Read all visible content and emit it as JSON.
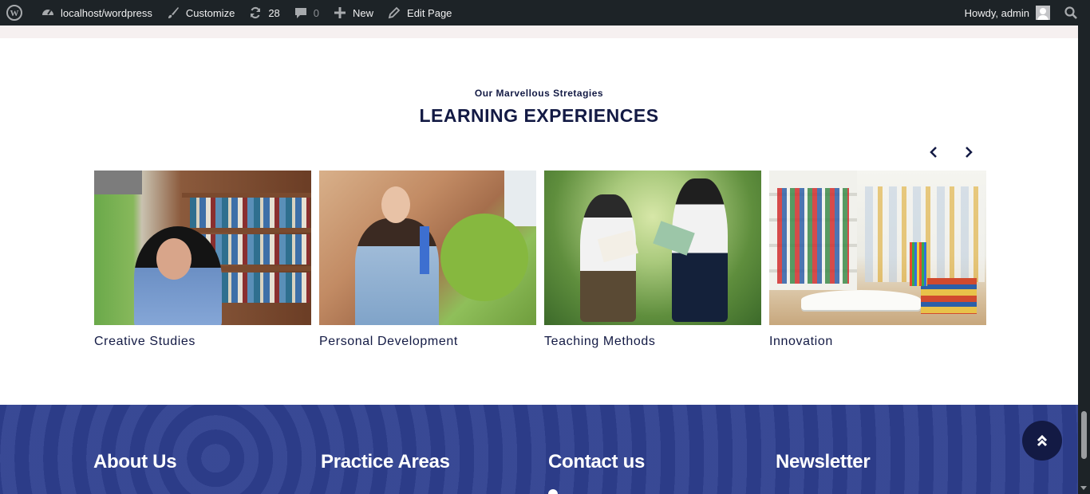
{
  "adminbar": {
    "site": "localhost/wordpress",
    "customize": "Customize",
    "updates": "28",
    "comments": "0",
    "new": "New",
    "edit": "Edit Page",
    "howdy": "Howdy, admin"
  },
  "section": {
    "eyebrow": "Our Marvellous Stretagies",
    "title": "LEARNING EXPERIENCES"
  },
  "cards": [
    {
      "caption": "Creative Studies"
    },
    {
      "caption": "Personal Development"
    },
    {
      "caption": "Teaching Methods"
    },
    {
      "caption": "Innovation"
    }
  ],
  "footer": {
    "about": "About Us",
    "practice": "Practice Areas",
    "contact": "Contact us",
    "newsletter": "Newsletter"
  },
  "colors": {
    "adminbar": "#1d2327",
    "heading": "#131a44",
    "footer": "#2e3f8f"
  }
}
